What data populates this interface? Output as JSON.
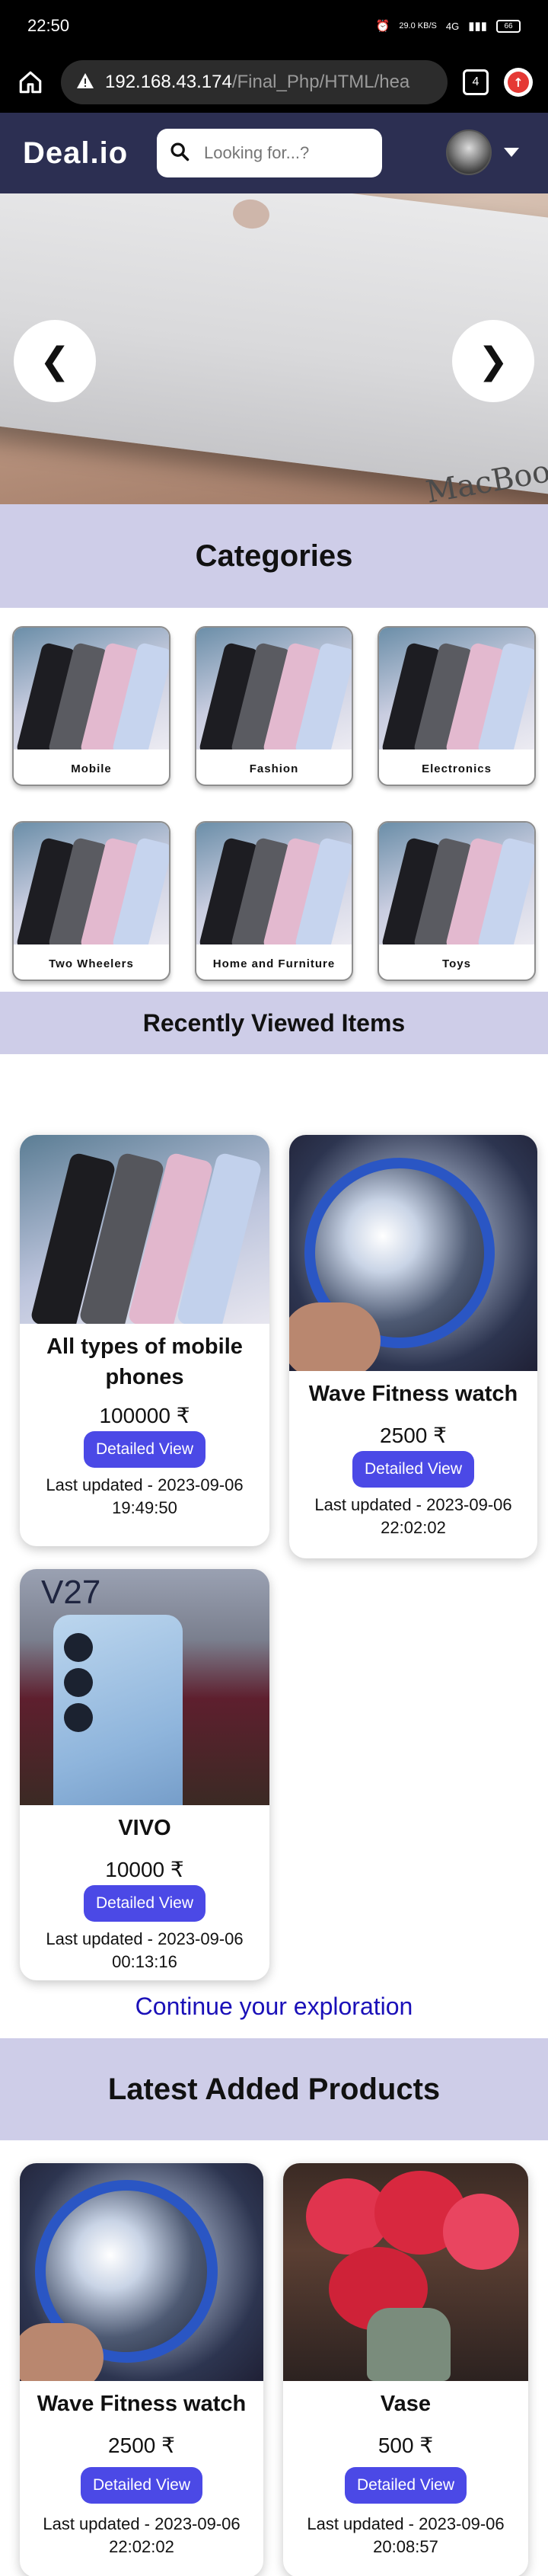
{
  "status_bar": {
    "time": "22:50",
    "net_speed": "29.0 KB/S",
    "signal": "4G",
    "battery": "66"
  },
  "browser": {
    "url_host": "192.168.43.174",
    "url_path": "/Final_Php/HTML/hea",
    "tab_count": "4"
  },
  "navbar": {
    "logo": "Deal.io",
    "search_placeholder": "Looking for...?"
  },
  "hero": {
    "prev": "❮",
    "next": "❯",
    "brand_mark": "MacBoo"
  },
  "categories": {
    "title": "Categories",
    "items": [
      {
        "label": "Mobile"
      },
      {
        "label": "Fashion"
      },
      {
        "label": "Electronics"
      },
      {
        "label": "Two Wheelers"
      },
      {
        "label": "Home and Furniture"
      },
      {
        "label": "Toys"
      }
    ]
  },
  "recently_viewed": {
    "title": "Recently Viewed Items",
    "items": [
      {
        "name_line1": "All types of mobile",
        "name_line2": "phones",
        "price": "100000 ₹",
        "button": "Detailed View",
        "updated_line1": "Last updated - 2023-09-06",
        "updated_line2": "19:49:50"
      },
      {
        "name_line1": "Wave Fitness watch",
        "name_line2": "",
        "price": "2500 ₹",
        "button": "Detailed View",
        "updated_line1": "Last updated - 2023-09-06",
        "updated_line2": "22:02:02"
      },
      {
        "name_line1": "VIVO",
        "name_line2": "",
        "price": "10000 ₹",
        "button": "Detailed View",
        "updated_line1": "Last updated - 2023-09-06",
        "updated_line2": "00:13:16"
      }
    ]
  },
  "continue_text": "Continue your exploration",
  "latest": {
    "title": "Latest Added Products",
    "items": [
      {
        "name": "Wave Fitness watch",
        "price": "2500 ₹",
        "button": "Detailed View",
        "updated_line1": "Last updated - 2023-09-06",
        "updated_line2": "22:02:02"
      },
      {
        "name": "Vase",
        "price": "500 ₹",
        "button": "Detailed View",
        "updated_line1": "Last updated - 2023-09-06",
        "updated_line2": "20:08:57"
      }
    ],
    "next_row_label": "V27"
  },
  "colors": {
    "navbar": "#2c2f52",
    "section_header": "#cecde8",
    "button": "#4b49e6",
    "link": "#1a10b8"
  }
}
